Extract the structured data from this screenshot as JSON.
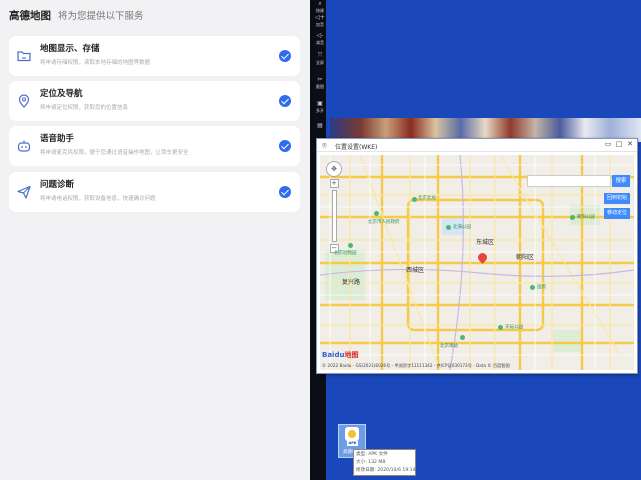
{
  "permission_screen": {
    "app_name": "高德地图",
    "subtitle": "将为您提供以下服务",
    "items": [
      {
        "title": "地图显示、存储",
        "desc": "将申请存储权限，读取本地存储的地图等数据",
        "icon": "folder-icon",
        "checked": true
      },
      {
        "title": "定位及导航",
        "desc": "将申请定位权限，获取您的位置信息",
        "icon": "location-pin-icon",
        "checked": true
      },
      {
        "title": "语音助手",
        "desc": "将申请麦克风权限，便于您通过语音操作地图，让驾车更安全",
        "icon": "robot-icon",
        "checked": true
      },
      {
        "title": "问题诊断",
        "desc": "将申请电话权限，获取设备信息，快速确诊问题",
        "icon": "paper-plane-icon",
        "checked": true
      }
    ],
    "accent_color": "#2f6cf0"
  },
  "sidebar": {
    "items": [
      {
        "glyph": "⌕",
        "label": "按键",
        "icon": "keymap-icon"
      },
      {
        "glyph": "◁+",
        "label": "加音",
        "icon": "volume-up-icon"
      },
      {
        "glyph": "◁-",
        "label": "减音",
        "icon": "volume-down-icon"
      },
      {
        "glyph": "⤧",
        "label": "全屏",
        "icon": "fullscreen-icon"
      },
      {
        "glyph": "✂",
        "label": "截图",
        "icon": "screenshot-icon"
      },
      {
        "glyph": "▣",
        "label": "多开",
        "icon": "multi-instance-icon"
      },
      {
        "glyph": "▤",
        "label": "",
        "icon": "more-icon"
      }
    ]
  },
  "map_window": {
    "title": "位置设置(WKE)",
    "controls": [
      "▭",
      "□",
      "✕"
    ],
    "search_button": "搜索",
    "buttons": [
      "回到初始",
      "移动定位"
    ],
    "district_labels": [
      {
        "text": "东城区"
      },
      {
        "text": "西城区"
      },
      {
        "text": "朝阳区"
      },
      {
        "text": "复兴路"
      }
    ],
    "poi_labels": [
      {
        "text": "北京市人民政府"
      },
      {
        "text": "北京动物园"
      },
      {
        "text": "北京北站"
      },
      {
        "text": "北海公园"
      },
      {
        "text": "天坛公园"
      },
      {
        "text": "北京南站"
      },
      {
        "text": "朝阳公园"
      },
      {
        "text": "国贸"
      }
    ],
    "baidu_logo": "Baidu",
    "baidu_logo_cn": "地图",
    "copyright": "© 2022 Baidu - GS(2021)6026号 - 甲测资字11111342 - 京ICP证030173号 - Data © 百度智图"
  },
  "desktop_file": {
    "badge": "APK",
    "label": "高德地图",
    "tooltip": {
      "type_line": "类型: APK 文件",
      "size_line": "大小: 132 MB",
      "date_line": "修改日期: 2020/10/6 19:14"
    }
  }
}
